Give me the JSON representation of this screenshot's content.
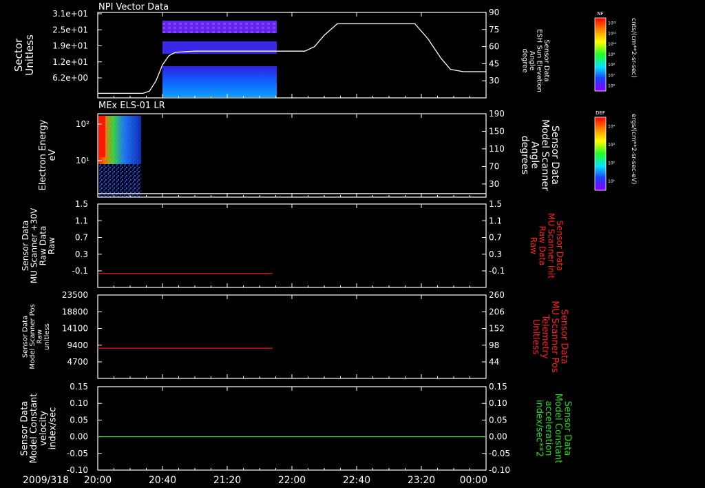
{
  "colors": {
    "background": "#000000",
    "axis": "#ffffff",
    "red": "#ff2020",
    "green": "#22dd22"
  },
  "time_axis": {
    "date": "2009/318",
    "ticks": [
      "20:00",
      "20:40",
      "21:20",
      "22:00",
      "22:40",
      "23:20",
      "00:00"
    ],
    "range_minutes": [
      0,
      240
    ]
  },
  "chart_data": [
    {
      "type": "heatmap",
      "title": "NPI Vector Data",
      "ylabel": [
        "Sector",
        "Unitless"
      ],
      "yticks": [
        "3.1e+01",
        "2.5e+01",
        "1.9e+01",
        "1.2e+01",
        "6.2e+00"
      ],
      "data_extent_minutes": [
        40,
        108
      ],
      "bands": [
        {
          "sector_range": [
            22,
            29
          ],
          "color": "violet/blue"
        },
        {
          "sector_range": [
            18,
            20
          ],
          "color": "blue"
        },
        {
          "sector_range": [
            0,
            12
          ],
          "color": "blue/cyan"
        }
      ],
      "right_axis": {
        "label": [
          "Sensor Data",
          "ESH Sun Elevation",
          "Angle",
          "degree"
        ],
        "ticks": [
          "90",
          "75",
          "60",
          "45",
          "30"
        ],
        "range": [
          15,
          90
        ]
      },
      "overlay_line": {
        "color": "#ffffff",
        "x_minutes": [
          0,
          12,
          28,
          32,
          36,
          40,
          44,
          48,
          60,
          100,
          128,
          134,
          140,
          148,
          180,
          196,
          204,
          212,
          218,
          226,
          240
        ],
        "y_deg": [
          19,
          19,
          19,
          21,
          30,
          44,
          52,
          55,
          56,
          56,
          56,
          60,
          70,
          80,
          80,
          80,
          67,
          50,
          40,
          38,
          38
        ]
      },
      "colorbar": {
        "label": "NF",
        "units": "cnts/(cm**2-sr-sec)",
        "ticks": [
          "10¹²",
          "10¹¹",
          "10¹⁰",
          "10⁹",
          "10⁸",
          "10⁷",
          "10⁶"
        ]
      }
    },
    {
      "type": "heatmap",
      "title": "MEx ELS-01 LR",
      "ylabel": [
        "Electron Energy",
        "eV"
      ],
      "yticks": [
        "10²",
        "10¹"
      ],
      "data_extent_minutes": [
        0,
        10
      ],
      "right_axis": {
        "label": [
          "Sensor Data",
          "Model Scanner",
          "Angle",
          "degrees"
        ],
        "ticks": [
          "190",
          "150",
          "110",
          "70",
          "30"
        ],
        "range": [
          0,
          190
        ]
      },
      "overlay_line": {
        "color": "#ffffff",
        "value_deg": 8
      },
      "colorbar": {
        "label": "DEF",
        "units": "ergs/(cm**2-sr-sec-eV)",
        "ticks": [
          "10⁴",
          "10³",
          "10²",
          "10¹"
        ]
      }
    },
    {
      "type": "line",
      "ylabel": [
        "Sensor Data",
        "MU Scanner +30V",
        "Raw Data",
        "Raw"
      ],
      "yticks": [
        "1.5",
        "1.1",
        "0.7",
        "0.3",
        "-0.1"
      ],
      "ylim": [
        -0.3,
        1.5
      ],
      "right_axis": {
        "label": [
          "Sensor Data",
          "MU Scanner Init",
          "Raw Data",
          "Raw"
        ],
        "ticks": [
          "1.5",
          "1.1",
          "0.7",
          "0.3",
          "-0.1"
        ]
      },
      "series": [
        {
          "color": "#ff2020",
          "x_minutes": [
            0,
            108
          ],
          "y": [
            0.0,
            0.0
          ]
        }
      ]
    },
    {
      "type": "line",
      "ylabel": [
        "Sensor Data",
        "Model Scanner Pos",
        "Raw",
        "unitless"
      ],
      "yticks": [
        "23500",
        "18800",
        "14100",
        "9400",
        "4700"
      ],
      "ylim": [
        0,
        23500
      ],
      "right_axis": {
        "label": [
          "Sensor Data",
          "MU Scanner Pos",
          "Telemetry",
          "Unitless"
        ],
        "ticks": [
          "260",
          "206",
          "152",
          "98",
          "44"
        ]
      },
      "series": [
        {
          "color": "#ff2020",
          "x_minutes": [
            0,
            108
          ],
          "y": [
            8500,
            8500
          ]
        }
      ]
    },
    {
      "type": "line",
      "ylabel": [
        "Sensor Data",
        "Model Constant",
        "velocity",
        "index/sec"
      ],
      "yticks": [
        "0.15",
        "0.10",
        "0.05",
        "0.00",
        "-0.05",
        "-0.10"
      ],
      "ylim": [
        -0.1,
        0.15
      ],
      "right_axis": {
        "label": [
          "Sensor Data",
          "Model Constant",
          "acceleration",
          "index/sec**2"
        ],
        "ticks": [
          "0.15",
          "0.10",
          "0.05",
          "0.00",
          "-0.05",
          "-0.10"
        ]
      },
      "series": [
        {
          "color": "#22dd22",
          "x_minutes": [
            0,
            240
          ],
          "y": [
            0.0,
            0.0
          ]
        }
      ]
    }
  ]
}
